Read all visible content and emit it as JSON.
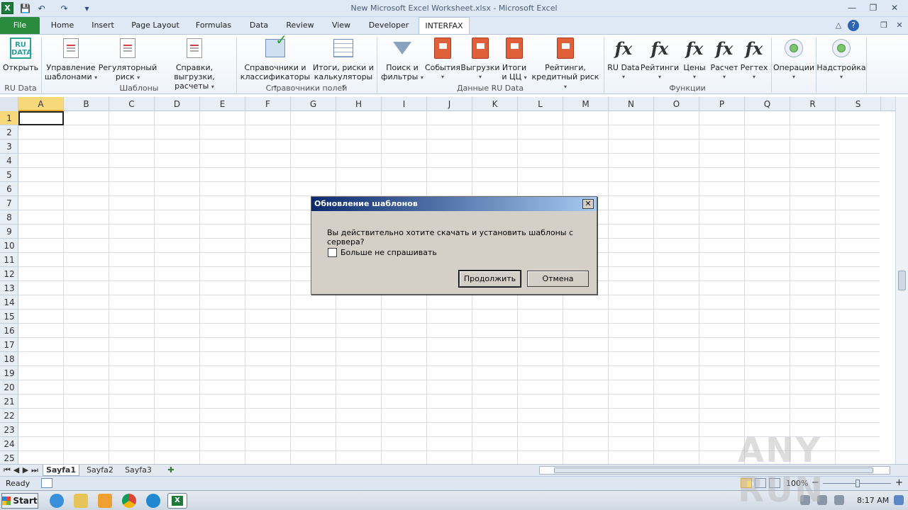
{
  "window": {
    "title": "New Microsoft Excel Worksheet.xlsx  -  Microsoft Excel",
    "minimize": "—",
    "restore": "❐",
    "close": "✕"
  },
  "qat": {
    "excel_icon": "X",
    "save": "💾",
    "undo": "↶",
    "redo": "↷",
    "customize": "▾"
  },
  "tabs": [
    {
      "label": "File"
    },
    {
      "label": "Home"
    },
    {
      "label": "Insert"
    },
    {
      "label": "Page Layout"
    },
    {
      "label": "Formulas"
    },
    {
      "label": "Data"
    },
    {
      "label": "Review"
    },
    {
      "label": "View"
    },
    {
      "label": "Developer"
    },
    {
      "label": "INTERFAX"
    }
  ],
  "tab_controls": {
    "minimize_ribbon": "△",
    "help": "?",
    "restore": "❐",
    "close": "✕"
  },
  "ribbon": {
    "groups": [
      {
        "label": "RU Data"
      },
      {
        "label": "Шаблоны"
      },
      {
        "label": "Справочники полей"
      },
      {
        "label": "Данные RU Data"
      },
      {
        "label": "Функции"
      }
    ],
    "buttons": {
      "open": {
        "label": "Открыть",
        "icon_text": "RU\nDATA"
      },
      "templates": {
        "line1": "Управление",
        "line2": "шаблонами"
      },
      "regulatory": {
        "line1": "Регуляторный",
        "line2": "риск"
      },
      "references": {
        "line1": "Справки, выгрузки,",
        "line2": "расчеты"
      },
      "classifiers": {
        "line1": "Справочники и",
        "line2": "классификаторы"
      },
      "totals": {
        "line1": "Итоги, риски и",
        "line2": "калькуляторы"
      },
      "search": {
        "line1": "Поиск и",
        "line2": "фильтры"
      },
      "events": {
        "line1": "События",
        "line2": ""
      },
      "exports": {
        "line1": "Выгрузки",
        "line2": ""
      },
      "totals_cc": {
        "line1": "Итоги",
        "line2": "и ЦЦ"
      },
      "ratings": {
        "line1": "Рейтинги,",
        "line2": "кредитный риск"
      },
      "fx_rudata": {
        "label": "RU Data"
      },
      "fx_ratings": {
        "label": "Рейтинги"
      },
      "fx_prices": {
        "label": "Цены"
      },
      "fx_calc": {
        "label": "Расчет"
      },
      "fx_regtech": {
        "label": "Регтех"
      },
      "operations": {
        "label": "Операции"
      },
      "addin": {
        "label": "Надстройка"
      },
      "fx_symbol": "fx",
      "dropdown": "▾"
    }
  },
  "columns": [
    "A",
    "B",
    "C",
    "D",
    "E",
    "F",
    "G",
    "H",
    "I",
    "J",
    "K",
    "L",
    "M",
    "N",
    "O",
    "P",
    "Q",
    "R",
    "S"
  ],
  "rows": [
    "1",
    "2",
    "3",
    "4",
    "5",
    "6",
    "7",
    "8",
    "9",
    "10",
    "11",
    "12",
    "13",
    "14",
    "15",
    "16",
    "17",
    "18",
    "19",
    "20",
    "21",
    "22",
    "23",
    "24",
    "25"
  ],
  "selected_cell": "A1",
  "dialog": {
    "title": "Обновление шаблонов",
    "message": "Вы действительно хотите скачать и установить шаблоны с сервера?",
    "checkbox_label": "Больше не спрашивать",
    "checkbox_checked": false,
    "continue_button": "Продолжить",
    "cancel_button": "Отмена",
    "close": "✕"
  },
  "sheets": {
    "nav": [
      "⏮",
      "◀",
      "▶",
      "⏭"
    ],
    "tabs": [
      "Sayfa1",
      "Sayfa2",
      "Sayfa3"
    ],
    "active": "Sayfa1",
    "new_sheet": "✚"
  },
  "status": {
    "ready": "Ready",
    "zoom": "100%",
    "zoom_out": "−",
    "zoom_in": "+"
  },
  "taskbar": {
    "start": "Start",
    "time": "8:17 AM"
  },
  "watermark": "ANY RUN",
  "colors": {
    "file_tab": "#2a8a3e",
    "selection": "#f7d97b",
    "dialog_title_start": "#0b2a6e"
  }
}
